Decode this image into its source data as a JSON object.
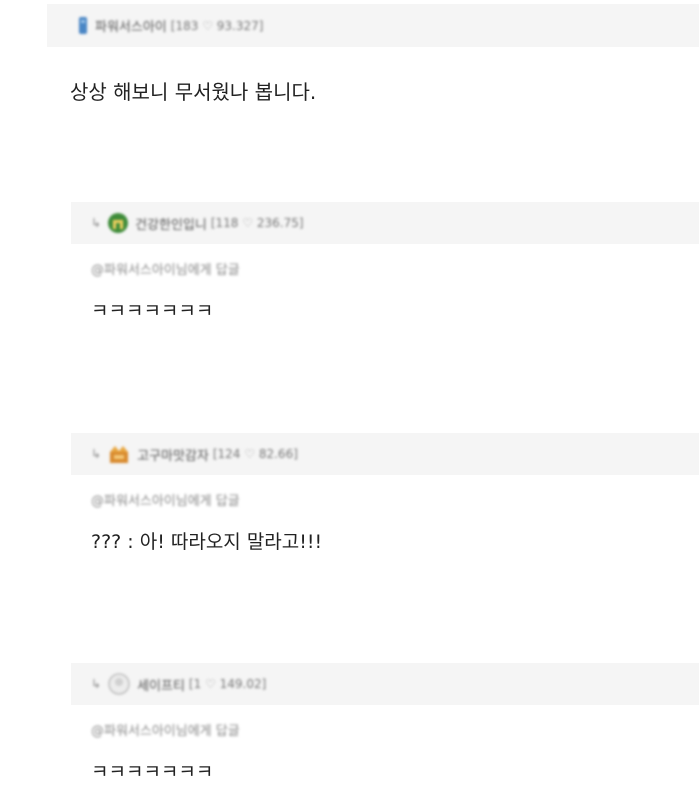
{
  "post": {
    "author": "파워서스아이",
    "stats_level": "[183",
    "stats_points": "93.327]",
    "body": "상상 해보니 무서웠나 봅니다."
  },
  "replies": [
    {
      "arrow": "↳",
      "author": "건강한인입니",
      "stats_level": "[118",
      "stats_points": "236.75]",
      "mention": "@파워서스아이님에게 답글",
      "text": "ㅋㅋㅋㅋㅋㅋㅋ",
      "avatar_icon": "green-shield-icon"
    },
    {
      "arrow": "↳",
      "author": "고구마맛감자",
      "stats_level": "[124",
      "stats_points": "82.66]",
      "mention": "@파워서스아이님에게 답글",
      "text": "??? : 아! 따라오지 말라고!!!",
      "avatar_icon": "orange-crown-icon"
    },
    {
      "arrow": "↳",
      "author": "세이프티",
      "stats_level": "[1",
      "stats_points": "149.02]",
      "mention": "@파워서스아이님에게 답글",
      "text": "ㅋㅋㅋㅋㅋㅋㅋ",
      "avatar_icon": "gray-circle-icon"
    }
  ]
}
